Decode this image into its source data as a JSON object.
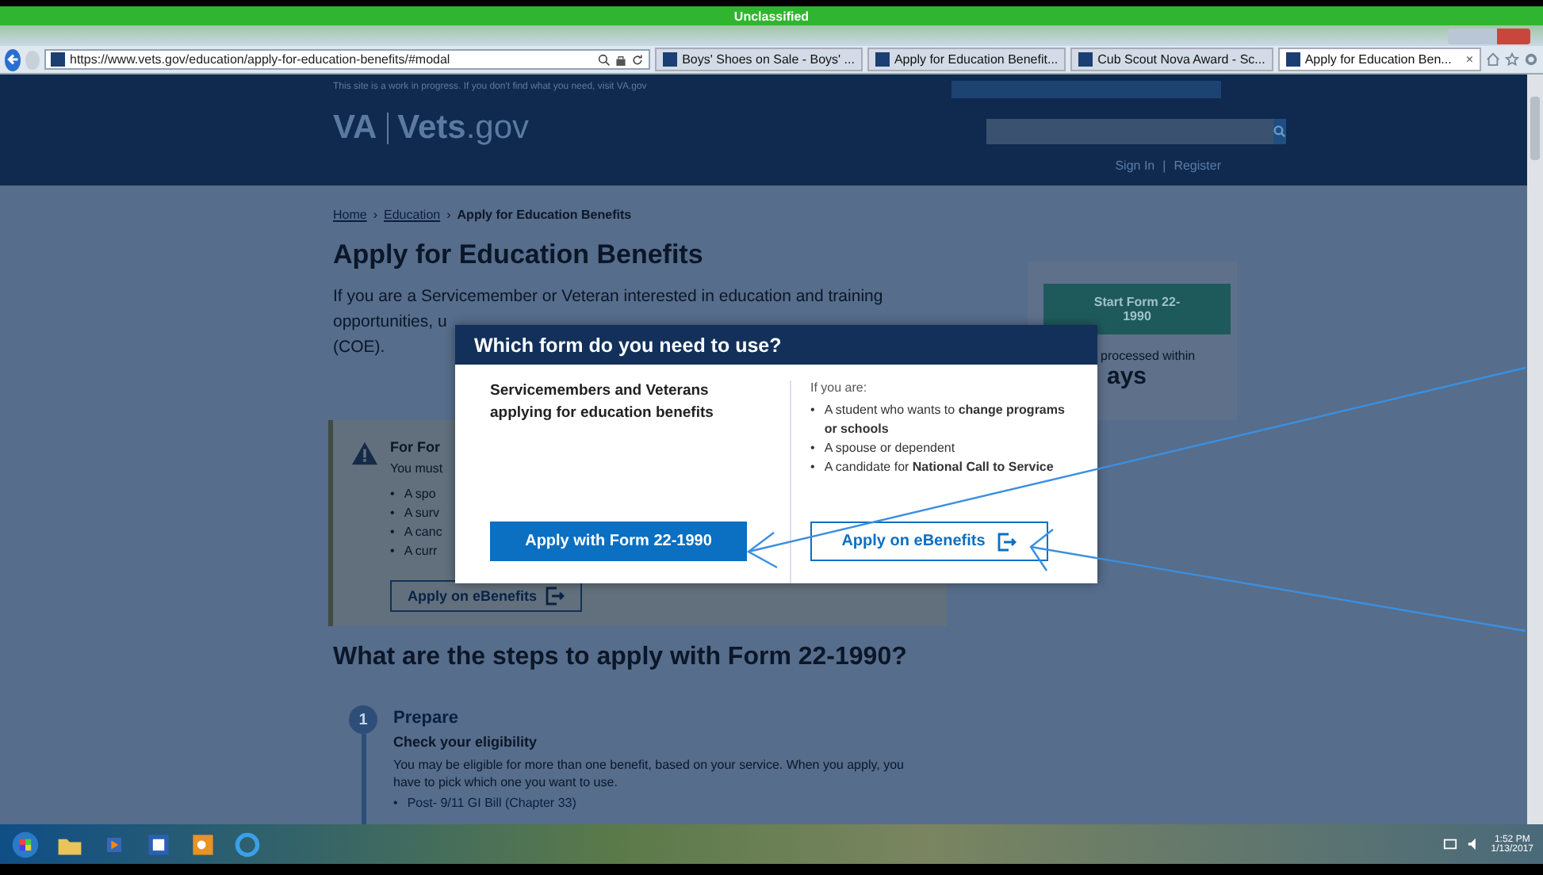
{
  "classification_banner": {
    "label": "Unclassified"
  },
  "browser": {
    "url": "https://www.vets.gov/education/apply-for-education-benefits/#modal",
    "tabs": [
      {
        "label": "Boys' Shoes on Sale - Boys' ...",
        "selected": false
      },
      {
        "label": "Apply for Education Benefit...",
        "selected": false
      },
      {
        "label": "Cub Scout Nova Award - Sc...",
        "selected": false
      },
      {
        "label": "Apply for Education Ben...",
        "selected": true,
        "close": "×"
      }
    ]
  },
  "site_header": {
    "notice": "This site is a work in progress. If you don't find what you need, visit VA.gov",
    "logo_va": "VA",
    "logo_site": "Vets",
    "logo_domain": ".gov",
    "sign_in": "Sign In",
    "separator": "|",
    "register": "Register"
  },
  "breadcrumbs": [
    {
      "label": "Home",
      "link": true
    },
    {
      "separator": "›",
      "label": "Education",
      "link": true
    },
    {
      "separator": "›",
      "label": "Apply for Education Benefits",
      "link": false
    }
  ],
  "page": {
    "title": "Apply for Education Benefits",
    "intro_lines": [
      "If you are a Servicemember or Veteran interested in education and training",
      "opportunities, u",
      "(COE)."
    ],
    "alert": {
      "title": "For For",
      "text": "You must",
      "bullet": "•",
      "items": [
        "A spo",
        "A surv",
        "A canc",
        "A curr"
      ],
      "button": "Apply on eBenefits"
    },
    "side": {
      "button_lines": [
        "Start Form 22-",
        "1990"
      ],
      "note": "processed within",
      "big": "ays"
    },
    "steps_title": "What are the steps to apply with Form 22-1990?",
    "steps": [
      {
        "number": "1",
        "title": "Prepare",
        "subtitle": "Check your eligibility",
        "text": "You may be eligible for more than one benefit, based on your service. When you apply, you have to pick which one you want to use.",
        "bullet": "•",
        "items": [
          "Post- 9/11 GI Bill (Chapter 33)"
        ]
      }
    ]
  },
  "modal": {
    "title": "Which form do you need to use?",
    "left_heading": "Servicemembers and Veterans applying for education benefits",
    "right_intro": "If you are:",
    "bullet": "•",
    "items": [
      "A student who wants to **change programs or schools**",
      "A spouse or dependent",
      "A candidate for **National Call to Service**"
    ],
    "primary_button": "Apply with Form 22-1990",
    "secondary_button": "Apply on eBenefits"
  },
  "taskbar": {
    "time": "1:52 PM",
    "date": "1/13/2017"
  }
}
